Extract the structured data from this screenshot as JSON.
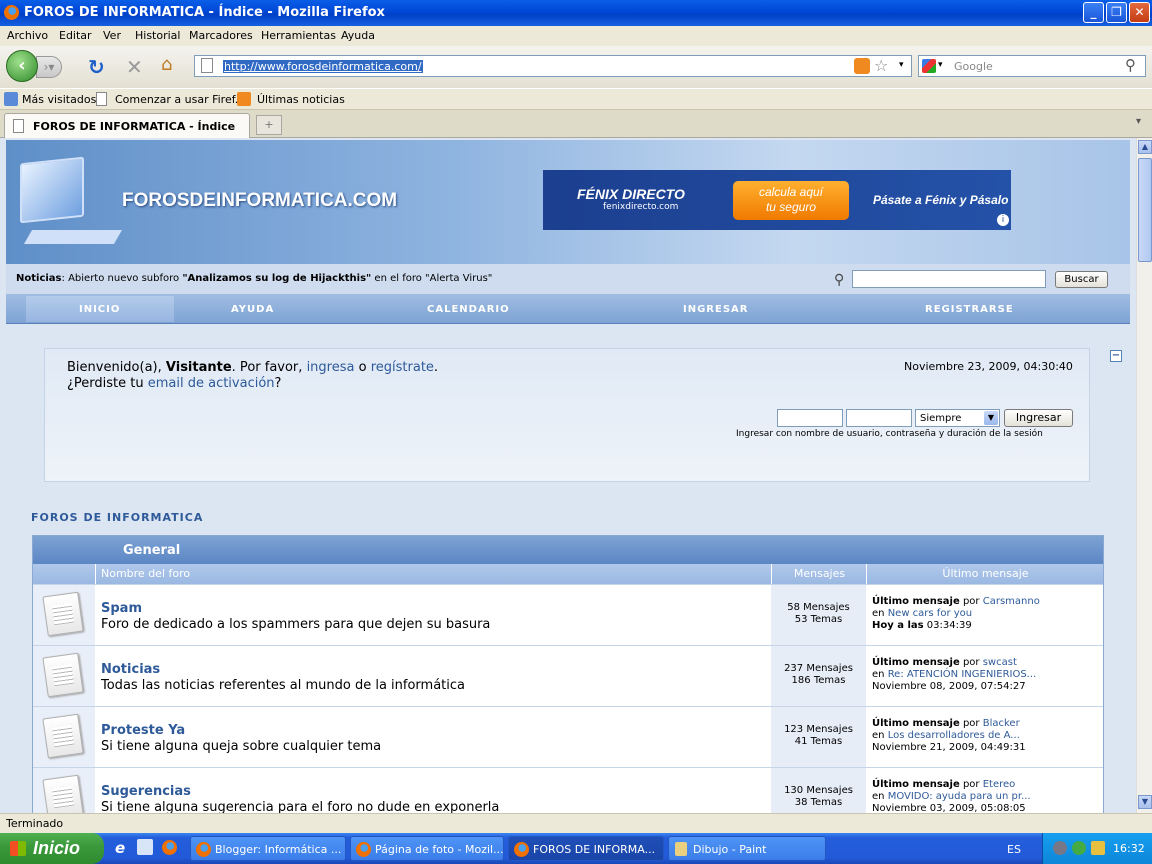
{
  "window": {
    "title": "FOROS DE INFORMATICA - Índice - Mozilla Firefox"
  },
  "menu": [
    "Archivo",
    "Editar",
    "Ver",
    "Historial",
    "Marcadores",
    "Herramientas",
    "Ayuda"
  ],
  "address": {
    "url": "http://www.forosdeinformatica.com/"
  },
  "search": {
    "placeholder": "Google"
  },
  "bookmarks": [
    "Más visitados",
    "Comenzar a usar Firef...",
    "Últimas noticias"
  ],
  "tab": {
    "title": "FOROS DE INFORMATICA - Índice"
  },
  "status": "Terminado",
  "banner": {
    "logo": "FOROSDEINFORMATICA.COM",
    "ad": {
      "brand": "FÉNIX DIRECTO",
      "site": "fenixdirecto.com",
      "cta_line1": "calcula aquí",
      "cta_line2": "tu seguro",
      "slogan": "Pásate a Fénix y Pásalo"
    }
  },
  "news": {
    "label": "Noticias",
    "text1": "Abierto nuevo subforo",
    "bold": "\"Analizamos su log de Hijackthis\"",
    "text2": "en el foro \"Alerta Virus\""
  },
  "site_search": {
    "button": "Buscar"
  },
  "nav": [
    "INICIO",
    "AYUDA",
    "CALENDARIO",
    "INGRESAR",
    "REGISTRARSE"
  ],
  "welcome": {
    "line1a": "Bienvenido(a),",
    "user": "Visitante",
    "line1b": ". Por favor,",
    "link_login": "ingresa",
    "or": "o",
    "link_register": "regístrate",
    "dot": ".",
    "line2a": "¿Perdiste tu",
    "link_email": "email de activación",
    "line2b": "?",
    "datetime": "Noviembre 23, 2009, 04:30:40",
    "duration": "Siempre",
    "login_button": "Ingresar",
    "login_hint": "Ingresar con nombre de usuario, contraseña y duración de la sesión"
  },
  "section_title": "FOROS DE INFORMATICA",
  "category": {
    "name": "General",
    "columns": [
      "Nombre del foro",
      "Mensajes",
      "Último mensaje"
    ],
    "forums": [
      {
        "name": "Spam",
        "desc": "Foro de dedicado a los spammers para que dejen su basura",
        "posts": "58 Mensajes",
        "topics": "53 Temas",
        "last_label": "Último mensaje",
        "by": "por",
        "author": "Carsmanno",
        "in": "en",
        "topic": "New cars for you",
        "date_bold": "Hoy a las",
        "date": "03:34:39"
      },
      {
        "name": "Noticias",
        "desc": "Todas las noticias referentes al mundo de la informática",
        "posts": "237 Mensajes",
        "topics": "186 Temas",
        "last_label": "Último mensaje",
        "by": "por",
        "author": "swcast",
        "in": "en",
        "topic": "Re: ATENCIÓN INGENIERIOS...",
        "date_bold": "",
        "date": "Noviembre 08, 2009, 07:54:27"
      },
      {
        "name": "Proteste Ya",
        "desc": "Si tiene alguna queja sobre cualquier tema",
        "posts": "123 Mensajes",
        "topics": "41 Temas",
        "last_label": "Último mensaje",
        "by": "por",
        "author": "Blacker",
        "in": "en",
        "topic": "Los desarrolladores de A...",
        "date_bold": "",
        "date": "Noviembre 21, 2009, 04:49:31"
      },
      {
        "name": "Sugerencias",
        "desc": "Si tiene alguna sugerencia para el foro no dude en exponerla",
        "posts": "130 Mensajes",
        "topics": "38 Temas",
        "last_label": "Último mensaje",
        "by": "por",
        "author": "Etereo",
        "in": "en",
        "topic": "MOVIDO: ayuda para un pr...",
        "date_bold": "",
        "date": "Noviembre 03, 2009, 05:08:05"
      }
    ]
  },
  "taskbar": {
    "start": "Inicio",
    "tasks": [
      "Blogger: Informática ...",
      "Página de foto - Mozil...",
      "FOROS DE INFORMA...",
      "Dibujo - Paint"
    ],
    "lang": "ES",
    "clock": "16:32"
  }
}
